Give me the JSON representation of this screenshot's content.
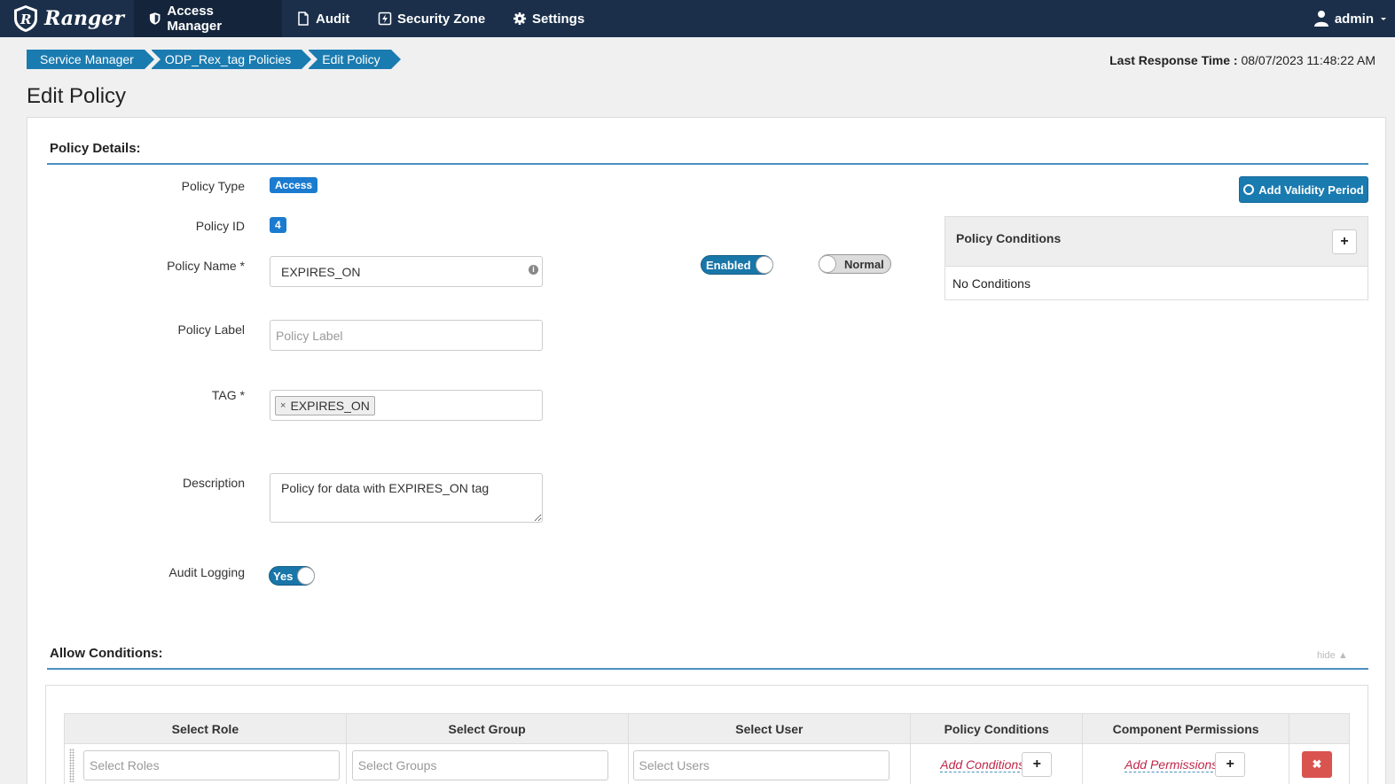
{
  "nav": {
    "brand": "Ranger",
    "items": [
      {
        "label": "Access Manager"
      },
      {
        "label": "Audit"
      },
      {
        "label": "Security Zone"
      },
      {
        "label": "Settings"
      }
    ],
    "user": "admin"
  },
  "breadcrumb": [
    "Service Manager",
    "ODP_Rex_tag Policies",
    "Edit Policy"
  ],
  "last_response": {
    "label": "Last Response Time :",
    "value": "08/07/2023 11:48:22 AM"
  },
  "page_title": "Edit Policy",
  "policy_details": {
    "heading": "Policy Details:",
    "policy_type_label": "Policy Type",
    "policy_type": "Access",
    "policy_id_label": "Policy ID",
    "policy_id": "4",
    "policy_name_label": "Policy Name *",
    "policy_name": "EXPIRES_ON",
    "enabled_toggle": "Enabled",
    "priority_toggle": "Normal",
    "policy_label_label": "Policy Label",
    "policy_label_placeholder": "Policy Label",
    "tag_label": "TAG *",
    "tag_value": "EXPIRES_ON",
    "tag_remove": "×",
    "description_label": "Description",
    "description": "Policy for data with EXPIRES_ON tag",
    "audit_logging_label": "Audit Logging",
    "audit_logging": "Yes",
    "add_validity": "Add Validity Period",
    "conditions_title": "Policy Conditions",
    "conditions_add": "+",
    "conditions_empty": "No Conditions"
  },
  "allow_conditions": {
    "heading": "Allow Conditions:",
    "hide": "hide",
    "columns": [
      "Select Role",
      "Select Group",
      "Select User",
      "Policy Conditions",
      "Component Permissions",
      ""
    ],
    "row": {
      "roles_placeholder": "Select Roles",
      "groups_placeholder": "Select Groups",
      "users_placeholder": "Select Users",
      "add_conditions": "Add Conditions",
      "add_permissions": "Add Permissions",
      "plus": "+",
      "delete": "✖"
    }
  }
}
